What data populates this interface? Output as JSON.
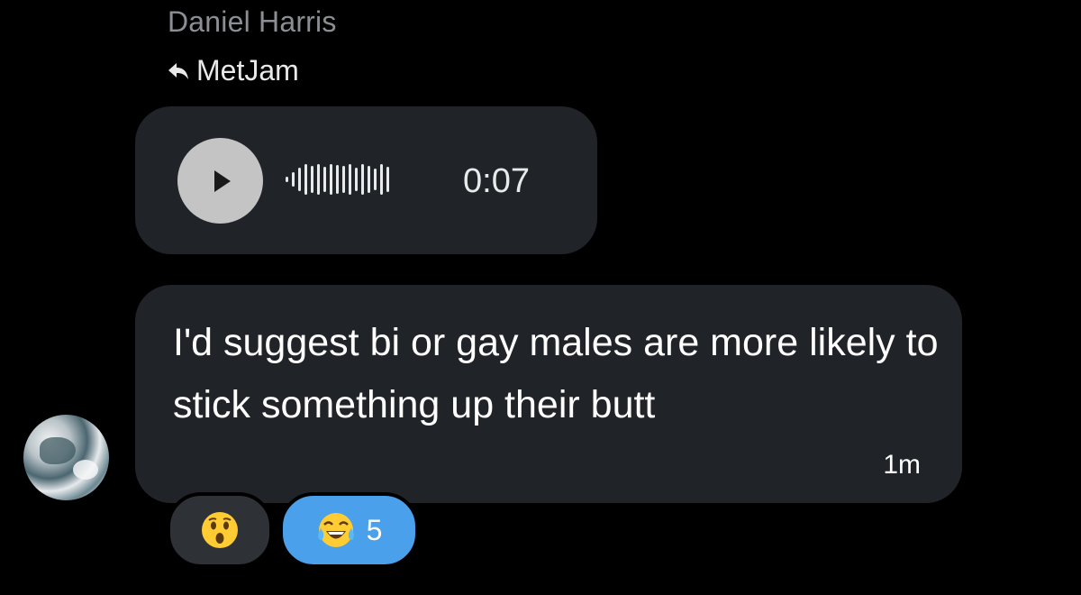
{
  "message": {
    "sender_name": "Daniel Harris",
    "reply_to": "MetJam",
    "voice_note": {
      "duration": "0:07",
      "play_icon": "play-icon"
    },
    "text": "I'd suggest bi or gay males are more likely to stick something up their butt",
    "timestamp": "1m"
  },
  "reactions": [
    {
      "emoji": "hushed-face",
      "count": ""
    },
    {
      "emoji": "face-with-tears-of-joy",
      "count": "5"
    }
  ],
  "colors": {
    "background": "#000000",
    "bubble": "#202327",
    "reaction_active": "#4aa0ea",
    "reaction_inactive": "#2e3237",
    "secondary_text": "#8b8f94"
  }
}
